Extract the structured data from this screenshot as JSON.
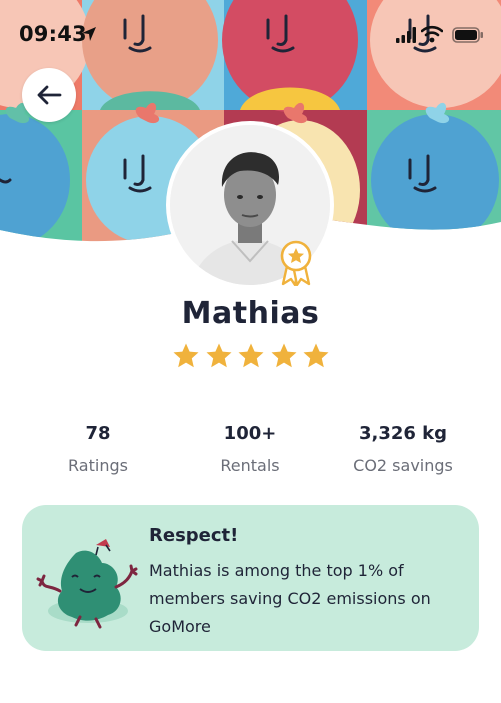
{
  "status_bar": {
    "time": "09:43"
  },
  "header": {
    "back_icon": "arrow-left-icon"
  },
  "profile": {
    "name": "Mathias",
    "rating_stars": 5,
    "badge_icon": "award-ribbon-icon"
  },
  "stats": [
    {
      "value": "78",
      "label": "Ratings"
    },
    {
      "value": "100+",
      "label": "Rentals"
    },
    {
      "value": "3,326 kg",
      "label": "CO2 savings"
    }
  ],
  "respect_card": {
    "title": "Respect!",
    "message": "Mathias is among the top 1% of members saving CO2 emissions on GoMore"
  },
  "colors": {
    "star": "#f0b23c",
    "card_background": "#c7ebdc",
    "text_dark": "#1f2437",
    "text_muted": "#6b6e78"
  }
}
